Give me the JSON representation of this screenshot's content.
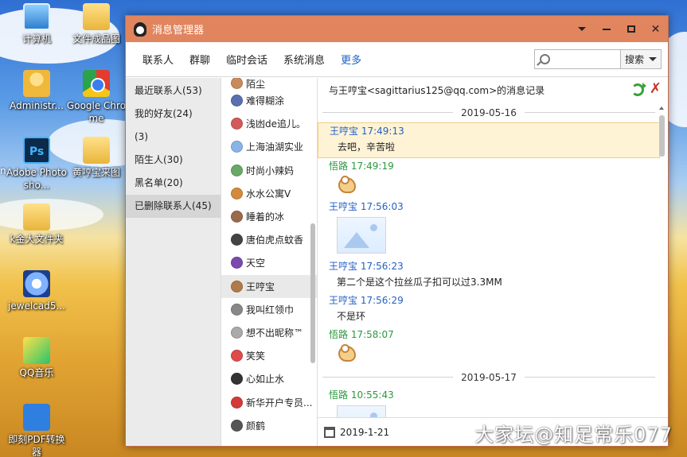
{
  "desktop": {
    "icons": [
      {
        "label": "计算机"
      },
      {
        "label": "文件成品图"
      },
      {
        "label": "Administr..."
      },
      {
        "label": "Google Chrome"
      },
      {
        "label": "Adobe Photosho..."
      },
      {
        "label": "黄哼宝来图"
      },
      {
        "label": "k金大文件夹"
      },
      {
        "label": "jewelcad5..."
      },
      {
        "label": "QQ音乐"
      },
      {
        "label": "即刻PDF转换器"
      }
    ],
    "stray_left_char": "n"
  },
  "window": {
    "title": "消息管理器",
    "icon": "qq-penguin-icon"
  },
  "toolbar": {
    "tabs": [
      "联系人",
      "群聊",
      "临时会话",
      "系统消息",
      "更多"
    ],
    "search_placeholder": "",
    "search_button": "搜索"
  },
  "categories": [
    {
      "label": "最近联系人(53)"
    },
    {
      "label": "我的好友(24)"
    },
    {
      "label": "(3)"
    },
    {
      "label": "陌生人(30)"
    },
    {
      "label": "黑名单(20)"
    },
    {
      "label": "已删除联系人(45)",
      "selected": true
    }
  ],
  "contacts": [
    {
      "name": "陌尘",
      "color": "#c98a5a"
    },
    {
      "name": "难得糊涂",
      "color": "#5a6fb0"
    },
    {
      "name": "浅凼de追儿。",
      "color": "#d45a5a"
    },
    {
      "name": "上海油湖实业",
      "color": "#8ab4e8"
    },
    {
      "name": "时尚小辣妈",
      "color": "#6aa86a"
    },
    {
      "name": "水水公寓V",
      "color": "#d48a3a"
    },
    {
      "name": "睡着的冰",
      "color": "#9a6a4a"
    },
    {
      "name": "唐伯虎点蚊香",
      "color": "#444444"
    },
    {
      "name": "天空",
      "color": "#7a4ab0"
    },
    {
      "name": "王哼宝",
      "color": "#b07a4a",
      "selected": true
    },
    {
      "name": "我叫红领巾",
      "color": "#888888"
    },
    {
      "name": "想不出昵称™",
      "color": "#aaaaaa"
    },
    {
      "name": "笑笑",
      "color": "#e04a4a"
    },
    {
      "name": "心如止水",
      "color": "#333333"
    },
    {
      "name": "新华开户专员...",
      "color": "#d43a3a"
    },
    {
      "name": "颜鹤",
      "color": "#555555"
    }
  ],
  "messages_panel": {
    "header": "与王哼宝<sagittarius125@qq.com>的消息记录",
    "refresh_icon": "refresh-icon",
    "delete_icon": "delete-icon",
    "items": [
      {
        "type": "date",
        "text": "2019-05-16"
      },
      {
        "type": "msg",
        "sender": "王哼宝",
        "time": "17:49:13",
        "color": "blue",
        "content_type": "text",
        "text": "去吧，辛苦啦",
        "highlight": true
      },
      {
        "type": "msg",
        "sender": "悟路",
        "time": "17:49:19",
        "color": "green",
        "content_type": "emoji"
      },
      {
        "type": "msg",
        "sender": "王哼宝",
        "time": "17:56:03",
        "color": "blue",
        "content_type": "image"
      },
      {
        "type": "msg",
        "sender": "王哼宝",
        "time": "17:56:23",
        "color": "blue",
        "content_type": "text",
        "text": "第二个是这个拉丝瓜子扣可以过3.3MM"
      },
      {
        "type": "msg",
        "sender": "王哼宝",
        "time": "17:56:29",
        "color": "blue",
        "content_type": "text",
        "text": "不是环"
      },
      {
        "type": "msg",
        "sender": "悟路",
        "time": "17:58:07",
        "color": "green",
        "content_type": "emoji"
      },
      {
        "type": "date",
        "text": "2019-05-17"
      },
      {
        "type": "msg",
        "sender": "悟路",
        "time": "10:55:43",
        "color": "green",
        "content_type": "image"
      }
    ],
    "footer_date": "2019-1-21"
  },
  "watermark": "大家坛@知足常乐077"
}
